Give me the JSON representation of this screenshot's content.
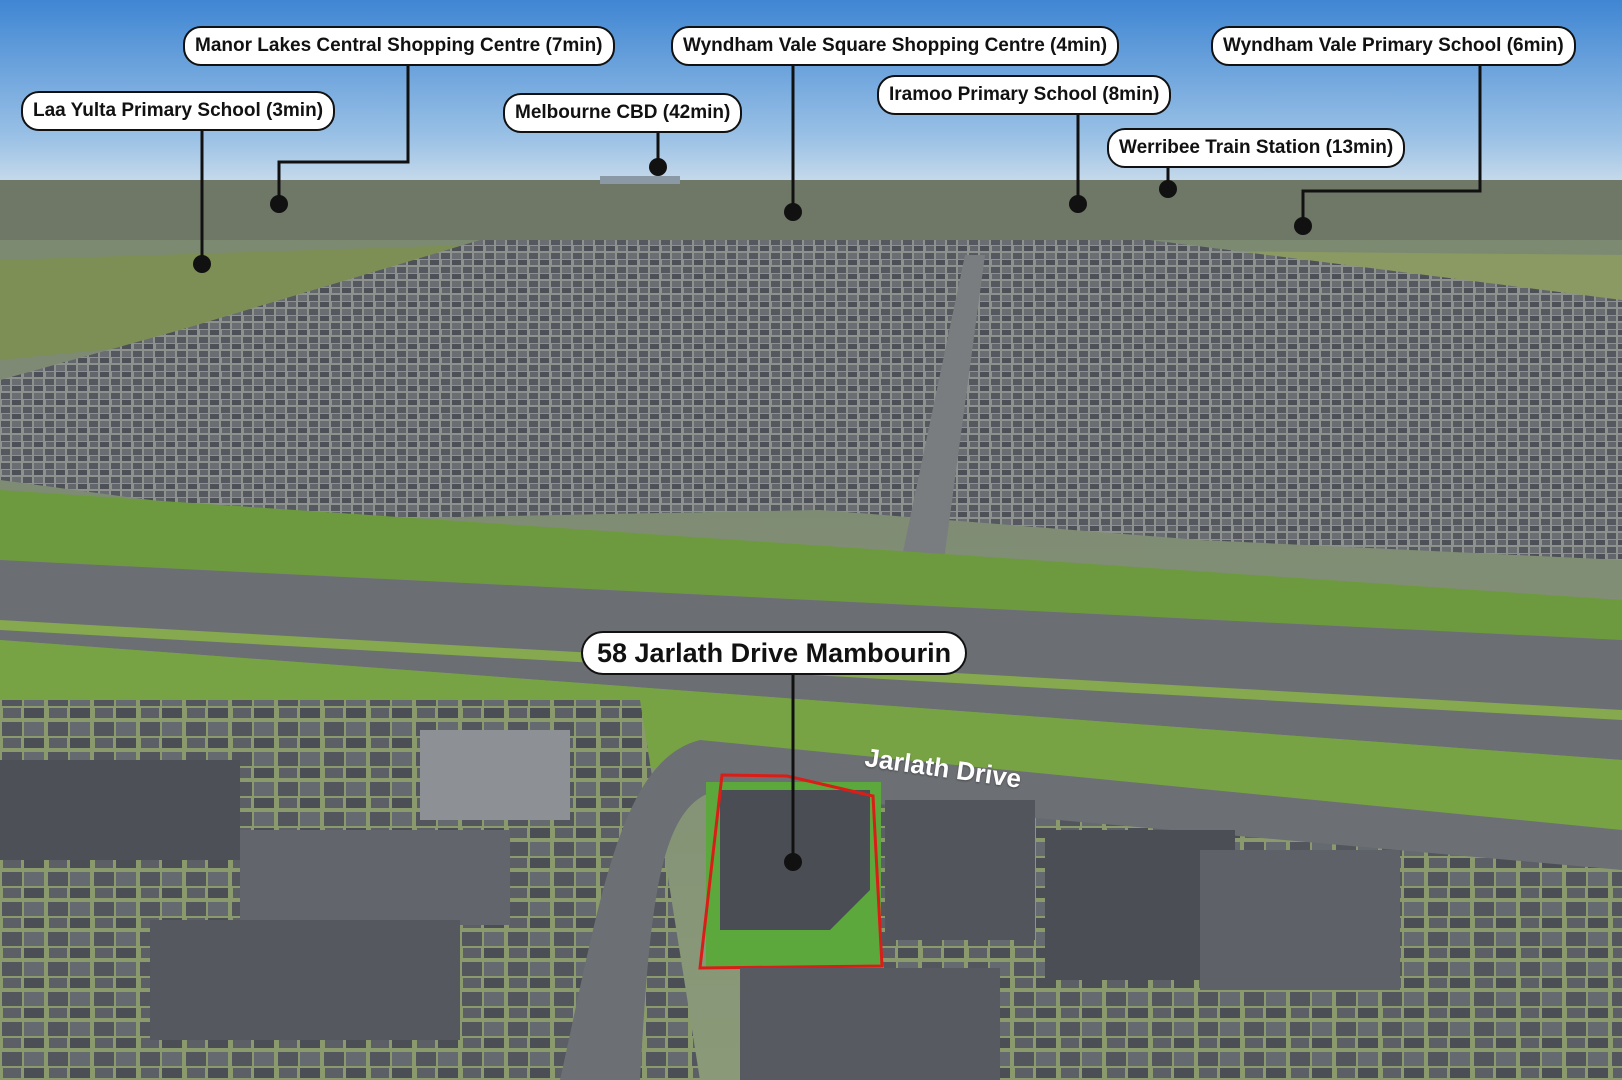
{
  "photo": {
    "description_free": true,
    "colors": {
      "sky_top": "#4f8fd6",
      "sky_bottom": "#c9dcee",
      "grass": "#6c9b3d",
      "road": "#707376",
      "roof_dark": "#4a4d52",
      "highlight": "#d91e18"
    }
  },
  "property": {
    "label": "58 Jarlath Drive Mambourin"
  },
  "street": {
    "label": "Jarlath Drive"
  },
  "pois": [
    {
      "label": "Laa Yulta Primary School (3min)"
    },
    {
      "label": "Manor Lakes Central Shopping Centre (7min)"
    },
    {
      "label": "Melbourne CBD (42min)"
    },
    {
      "label": "Wyndham Vale Square Shopping Centre (4min)"
    },
    {
      "label": "Iramoo Primary School (8min)"
    },
    {
      "label": "Werribee Train Station (13min)"
    },
    {
      "label": "Wyndham Vale Primary School (6min)"
    }
  ]
}
